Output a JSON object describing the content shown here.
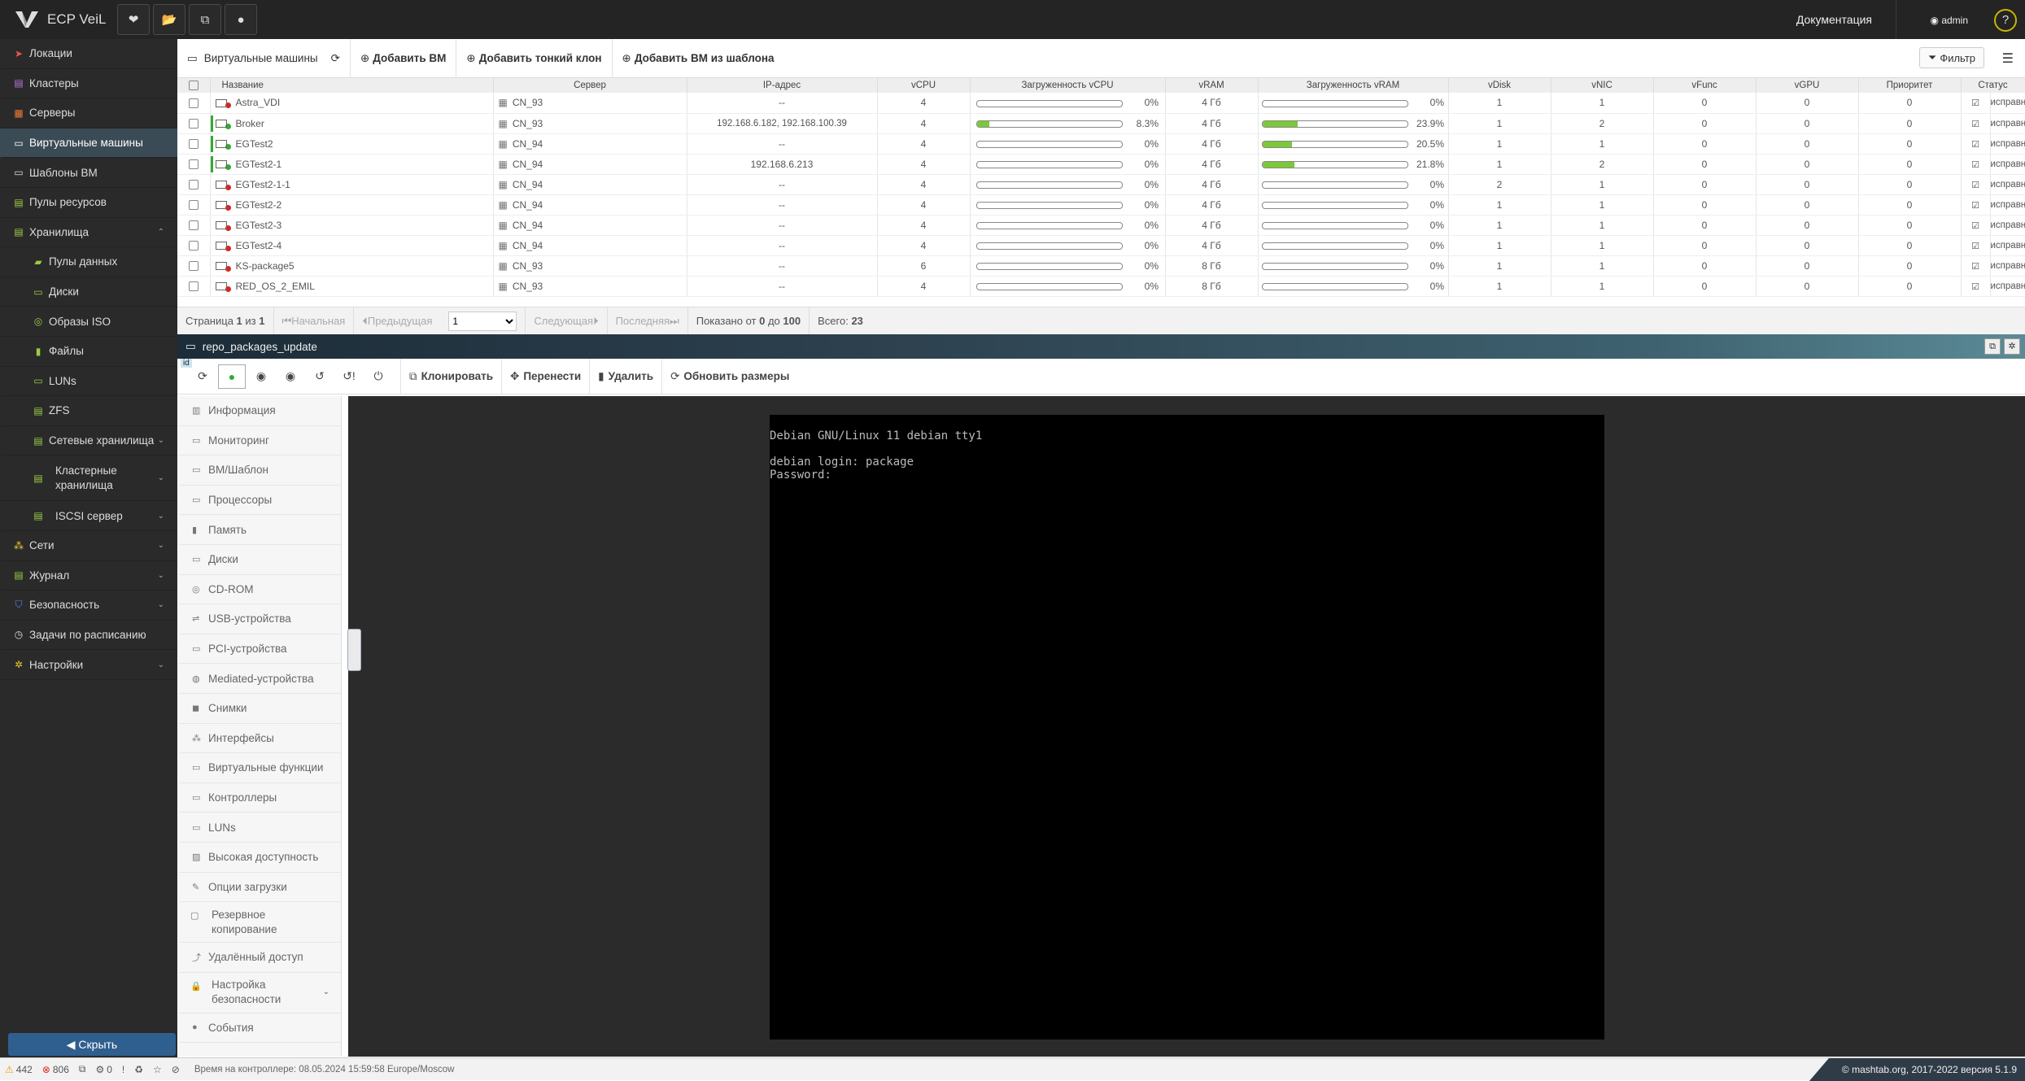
{
  "app": {
    "title": "ECP VeiL"
  },
  "header": {
    "docs": "Документация",
    "user": "admin",
    "help": "?"
  },
  "sidebar": {
    "items": [
      {
        "label": "Локации",
        "icon": "location-icon"
      },
      {
        "label": "Кластеры",
        "icon": "cluster-icon"
      },
      {
        "label": "Серверы",
        "icon": "server-icon"
      },
      {
        "label": "Виртуальные машины",
        "icon": "vm-icon"
      },
      {
        "label": "Шаблоны ВМ",
        "icon": "template-icon"
      },
      {
        "label": "Пулы ресурсов",
        "icon": "pool-icon"
      },
      {
        "label": "Хранилища",
        "icon": "storage-icon"
      },
      {
        "label": "Пулы данных",
        "icon": "datapool-icon"
      },
      {
        "label": "Диски",
        "icon": "disk-icon"
      },
      {
        "label": "Образы ISO",
        "icon": "iso-icon"
      },
      {
        "label": "Файлы",
        "icon": "file-icon"
      },
      {
        "label": "LUNs",
        "icon": "lun-icon"
      },
      {
        "label": "ZFS",
        "icon": "zfs-icon"
      },
      {
        "label": "Сетевые хранилища",
        "icon": "netstorage-icon"
      },
      {
        "label": "Кластерные хранилища",
        "icon": "clusterstorage-icon"
      },
      {
        "label": "ISCSI сервер",
        "icon": "iscsi-icon"
      },
      {
        "label": "Сети",
        "icon": "network-icon"
      },
      {
        "label": "Журнал",
        "icon": "journal-icon"
      },
      {
        "label": "Безопасность",
        "icon": "security-icon"
      },
      {
        "label": "Задачи по расписанию",
        "icon": "schedule-icon"
      },
      {
        "label": "Настройки",
        "icon": "settings-icon"
      }
    ],
    "hide": "Скрыть"
  },
  "vmlist": {
    "title": "Виртуальные машины",
    "add_vm": "Добавить ВМ",
    "add_thin": "Добавить тонкий клон",
    "add_from_tpl": "Добавить ВМ из шаблона",
    "filter": "Фильтр",
    "columns": [
      "Название",
      "Сервер",
      "IP-адрес",
      "vCPU",
      "Загруженность vCPU",
      "vRAM",
      "Загруженность vRAM",
      "vDisk",
      "vNIC",
      "vFunc",
      "vGPU",
      "Приоритет",
      "Статус"
    ],
    "rows": [
      {
        "name": "Astra_VDI",
        "server": "CN_93",
        "ip": "--",
        "vcpu": "4",
        "cpu_load": "0%",
        "cpu_fill": 0,
        "vram": "4 Гб",
        "ram_load": "0%",
        "ram_fill": 0,
        "vdisk": "1",
        "vnic": "1",
        "vfunc": "0",
        "vgpu": "0",
        "prio": "0",
        "status": "исправно",
        "state": "off"
      },
      {
        "name": "Broker",
        "server": "CN_93",
        "ip": "192.168.6.182, 192.168.100.39",
        "vcpu": "4",
        "cpu_load": "8.3%",
        "cpu_fill": 8.3,
        "vram": "4 Гб",
        "ram_load": "23.9%",
        "ram_fill": 23.9,
        "vdisk": "1",
        "vnic": "2",
        "vfunc": "0",
        "vgpu": "0",
        "prio": "0",
        "status": "исправно",
        "state": "on"
      },
      {
        "name": "EGTest2",
        "server": "CN_94",
        "ip": "--",
        "vcpu": "4",
        "cpu_load": "0%",
        "cpu_fill": 0,
        "vram": "4 Гб",
        "ram_load": "20.5%",
        "ram_fill": 20.5,
        "vdisk": "1",
        "vnic": "1",
        "vfunc": "0",
        "vgpu": "0",
        "prio": "0",
        "status": "исправно",
        "state": "on"
      },
      {
        "name": "EGTest2-1",
        "server": "CN_94",
        "ip": "192.168.6.213",
        "vcpu": "4",
        "cpu_load": "0%",
        "cpu_fill": 0,
        "vram": "4 Гб",
        "ram_load": "21.8%",
        "ram_fill": 21.8,
        "vdisk": "1",
        "vnic": "2",
        "vfunc": "0",
        "vgpu": "0",
        "prio": "0",
        "status": "исправно",
        "state": "on"
      },
      {
        "name": "EGTest2-1-1",
        "server": "CN_94",
        "ip": "--",
        "vcpu": "4",
        "cpu_load": "0%",
        "cpu_fill": 0,
        "vram": "4 Гб",
        "ram_load": "0%",
        "ram_fill": 0,
        "vdisk": "2",
        "vnic": "1",
        "vfunc": "0",
        "vgpu": "0",
        "prio": "0",
        "status": "исправно",
        "state": "off"
      },
      {
        "name": "EGTest2-2",
        "server": "CN_94",
        "ip": "--",
        "vcpu": "4",
        "cpu_load": "0%",
        "cpu_fill": 0,
        "vram": "4 Гб",
        "ram_load": "0%",
        "ram_fill": 0,
        "vdisk": "1",
        "vnic": "1",
        "vfunc": "0",
        "vgpu": "0",
        "prio": "0",
        "status": "исправно",
        "state": "off"
      },
      {
        "name": "EGTest2-3",
        "server": "CN_94",
        "ip": "--",
        "vcpu": "4",
        "cpu_load": "0%",
        "cpu_fill": 0,
        "vram": "4 Гб",
        "ram_load": "0%",
        "ram_fill": 0,
        "vdisk": "1",
        "vnic": "1",
        "vfunc": "0",
        "vgpu": "0",
        "prio": "0",
        "status": "исправно",
        "state": "off"
      },
      {
        "name": "EGTest2-4",
        "server": "CN_94",
        "ip": "--",
        "vcpu": "4",
        "cpu_load": "0%",
        "cpu_fill": 0,
        "vram": "4 Гб",
        "ram_load": "0%",
        "ram_fill": 0,
        "vdisk": "1",
        "vnic": "1",
        "vfunc": "0",
        "vgpu": "0",
        "prio": "0",
        "status": "исправно",
        "state": "off"
      },
      {
        "name": "KS-package5",
        "server": "CN_93",
        "ip": "--",
        "vcpu": "6",
        "cpu_load": "0%",
        "cpu_fill": 0,
        "vram": "8 Гб",
        "ram_load": "0%",
        "ram_fill": 0,
        "vdisk": "1",
        "vnic": "1",
        "vfunc": "0",
        "vgpu": "0",
        "prio": "0",
        "status": "исправно",
        "state": "off"
      },
      {
        "name": "RED_OS_2_EMIL",
        "server": "CN_93",
        "ip": "--",
        "vcpu": "4",
        "cpu_load": "0%",
        "cpu_fill": 0,
        "vram": "8 Гб",
        "ram_load": "0%",
        "ram_fill": 0,
        "vdisk": "1",
        "vnic": "1",
        "vfunc": "0",
        "vgpu": "0",
        "prio": "0",
        "status": "исправно",
        "state": "off"
      }
    ]
  },
  "pager": {
    "page_prefix": "Страница",
    "page": "1",
    "of": "из",
    "total_pages": "1",
    "first": "Начальная",
    "prev": "Предыдущая",
    "page_select": "1",
    "next": "Следующая",
    "last": "Последняя",
    "shown_prefix": "Показано от",
    "from": "0",
    "to_word": "до",
    "to": "100",
    "total_label": "Всего:",
    "total": "23"
  },
  "panel": {
    "title": "repo_packages_update",
    "id_tag": "id"
  },
  "actions": {
    "clone": "Клонировать",
    "move": "Перенести",
    "delete": "Удалить",
    "refresh_sizes": "Обновить размеры"
  },
  "vmmenu": [
    {
      "label": "Информация"
    },
    {
      "label": "Мониторинг"
    },
    {
      "label": "ВМ/Шаблон"
    },
    {
      "label": "Процессоры"
    },
    {
      "label": "Память"
    },
    {
      "label": "Диски"
    },
    {
      "label": "CD-ROM"
    },
    {
      "label": "USB-устройства"
    },
    {
      "label": "PCI-устройства"
    },
    {
      "label": "Mediated-устройства"
    },
    {
      "label": "Снимки"
    },
    {
      "label": "Интерфейсы"
    },
    {
      "label": "Виртуальные функции"
    },
    {
      "label": "Контроллеры"
    },
    {
      "label": "LUNs"
    },
    {
      "label": "Высокая доступность"
    },
    {
      "label": "Опции загрузки"
    },
    {
      "label": "Резервное копирование"
    },
    {
      "label": "Удалённый доступ"
    },
    {
      "label": "Настройка безопасности"
    },
    {
      "label": "События"
    }
  ],
  "console": {
    "lines": [
      "Debian GNU/Linux 11 debian tty1",
      "",
      "debian login: package",
      "Password:"
    ]
  },
  "status": {
    "warnings": "442",
    "errors": "806",
    "tasks": "0",
    "time": "Время на контроллере: 08.05.2024 15:59:58 Europe/Moscow",
    "copyright": "© mashtab.org, 2017-2022 версия 5.1.9"
  }
}
